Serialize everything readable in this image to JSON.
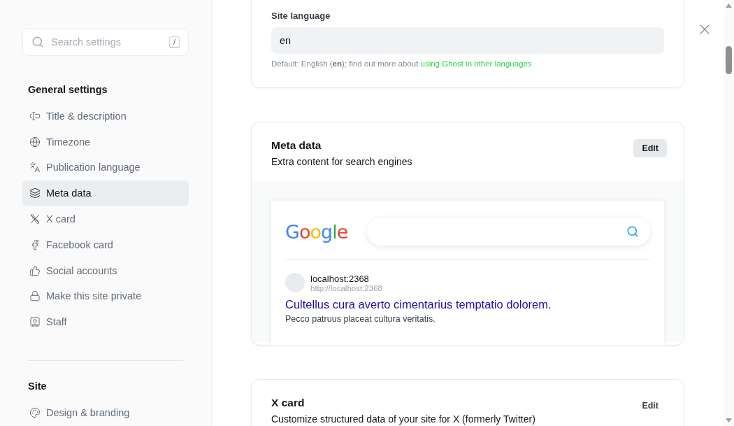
{
  "sidebar": {
    "search": {
      "placeholder": "Search settings",
      "shortcut": "/"
    },
    "sections": [
      {
        "title": "General settings",
        "items": [
          {
            "label": "Title & description",
            "selected": false
          },
          {
            "label": "Timezone",
            "selected": false
          },
          {
            "label": "Publication language",
            "selected": false
          },
          {
            "label": "Meta data",
            "selected": true
          },
          {
            "label": "X card",
            "selected": false
          },
          {
            "label": "Facebook card",
            "selected": false
          },
          {
            "label": "Social accounts",
            "selected": false
          },
          {
            "label": "Make this site private",
            "selected": false
          },
          {
            "label": "Staff",
            "selected": false
          }
        ]
      },
      {
        "title": "Site",
        "items": [
          {
            "label": "Design & branding",
            "selected": false
          }
        ]
      }
    ]
  },
  "cards": [
    {
      "kind": "field",
      "label": "Site language",
      "value": "en",
      "hint": "Default: English (**en**); find out more about ",
      "link": "using Ghost in other languages"
    },
    {
      "kind": "preview",
      "title": "Meta data",
      "subtitle": "Extra content for search engines",
      "button": {
        "label": "Edit",
        "highlighted": true
      },
      "preview": {
        "logo": "Google",
        "site_name": "localhost:2368",
        "url": "http://localhost:2368",
        "result_title": "Cultellus cura averto cimentarius temptatio dolorem.",
        "result_description": "Pecco patruus placeat cultura veritatis."
      }
    },
    {
      "kind": "plain",
      "title": "X card",
      "subtitle": "Customize structured data of your site for X (formerly Twitter)",
      "button": {
        "label": "Edit",
        "highlighted": false
      }
    }
  ]
}
